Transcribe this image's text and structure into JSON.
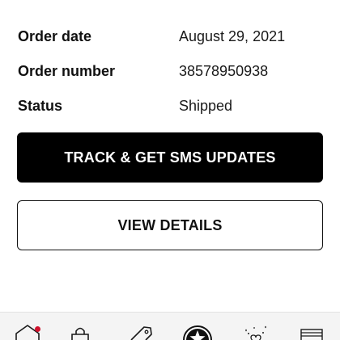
{
  "order": {
    "rows": [
      {
        "label": "Order date",
        "value": "August 29, 2021"
      },
      {
        "label": "Order number",
        "value": "38578950938"
      },
      {
        "label": "Status",
        "value": "Shipped"
      }
    ]
  },
  "actions": {
    "track_label": "TRACK & GET SMS UPDATES",
    "details_label": "VIEW DETAILS"
  },
  "tabbar": {
    "items": [
      {
        "icon": "home-icon",
        "has_notification_dot": true
      },
      {
        "icon": "shopping-bag-icon"
      },
      {
        "icon": "tag-icon"
      },
      {
        "icon": "beauty-insider-star-icon"
      },
      {
        "icon": "sparkle-heart-icon"
      },
      {
        "icon": "menu-icon"
      }
    ],
    "accent_color": "#cf112c"
  }
}
